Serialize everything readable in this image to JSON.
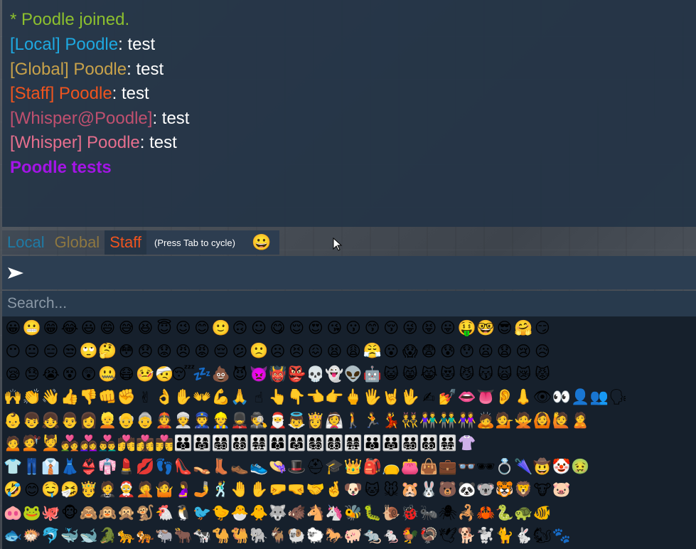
{
  "chat_log": {
    "lines": [
      {
        "prefix": "",
        "name": "  * Poodle joined.",
        "text": ""
      },
      {
        "prefix": "[Local] Poodle",
        "text": ": test"
      },
      {
        "prefix": "[Global] Poodle",
        "text": ": test"
      },
      {
        "prefix": "[Staff] Poodle",
        "text": ": test"
      },
      {
        "prefix": "[Whisper@Poodle]",
        "text": ": test"
      },
      {
        "prefix": "[Whisper] Poodle",
        "text": ": test"
      },
      {
        "prefix": "Poodle tests",
        "text": ""
      }
    ]
  },
  "tabs": {
    "local": "Local",
    "global": "Global",
    "staff": "Staff",
    "hint": "(Press Tab to cycle)",
    "emoji": "😀"
  },
  "input": {
    "value": "",
    "send_icon": "send-arrow-icon"
  },
  "search": {
    "placeholder": "Search..."
  },
  "emoji_rows": [
    "😀 😬 😁 😂 😃 😄 😅 😆 😇 😉 😊 🙂 🙃 ☺ 😋 😌 😍 😘 😗 😙 😚 😜 😝 😛 🤑 🤓 😎 🤗 😏",
    "😶 😐 😑 😒 🙄 🤔 😳 😞 😟 😠 😡 😔 😕 🙁 ☹ 😣 😖 😫 😩 😤 😮 😱 😨 😰 😯 😦 😧 😢 😥",
    "😪 😓 😭 😵 😲 🤐 😷 🤒 🤕 😴 💤 💩 😈 👿 👹 👺 💀 👻 👽 🤖 😺 😸 😹 😻 😼 😽 🙀 😿 😾",
    "🙌 👏 👋 👍 👎 👊 ✊ ✌ 👌 ✋ 👐 💪 🙏 ☝ 👆 👇 👈 👉 🖕 🖐 🤘 🖖 ✍ 💅 👄 👅 👂 👃 👁 👀 👤 👥 🗣",
    "👶 👦 👧 👨 👩 👱 👴 👵 👲 👳 👮 👷 💂 🕵 🎅 👼 👸 👰 🚶 🏃 💃 👯 👫 👬 👭 🙇 💁 🙅 🙆 🙋 🙎",
    "🙍 💇 💆 💑 👩‍❤️‍👩 👨‍❤️‍👨 💏 👩‍❤️‍💋‍👩 👨‍❤️‍💋‍👨 👪 👨‍👩‍👧 👨‍👩‍👧‍👦 👨‍👩‍👦‍👦 👨‍👩‍👧‍👧 👩‍👩‍👦 👩‍👩‍👧 👩‍👩‍👧‍👦 👩‍👩‍👦‍👦 👩‍👩‍👧‍👧 👨‍👨‍👦 👨‍👨‍👧 👨‍👨‍👧‍👦 👨‍👨‍👦‍👦 👨‍👨‍👧‍👧 👚",
    "👕 👖 👔 👗 👙 👘 💄 💋 👣 👠 👡 👢 👞 👟 👒 🎩 ⛑ 🎓 👑 🎒 👝 👛 👜 💼 👓 🕶 💍 🌂 🤠 🤡 🤢",
    "🤣 😊 🤤 🤧 🤴 🤵 🤶 🤦 🤷 🤰 🤳 🕺 🤚 ✋ 🤛 🤜 🤝 🤞 🐶 🐱 🐭 🐹 🐰 🐻 🐼 🐨 🐯 🦁 🐮 🐷",
    "🐽 🐸 🐙 🐵 🙈 🙉 🙊 🐒 🐔 🐧 🐦 🐤 🐣 🐥 🐺 🐗 🐴 🦄 🐝 🐛 🐌 🐞 🐜 🕷 🦂 🦀 🐍 🐢 🐠",
    "🐟 🐡 🐬 🐳 🐋 🐊 🐆 🐅 🐃 🐂 🐄 🐪 🐫 🐘 🐐 🐏 🐑 🐎 🐖 🐀 🐁 🐓 🦃 🕊 🐕 🐩 🐈 🐇 🐿 🐾"
  ]
}
